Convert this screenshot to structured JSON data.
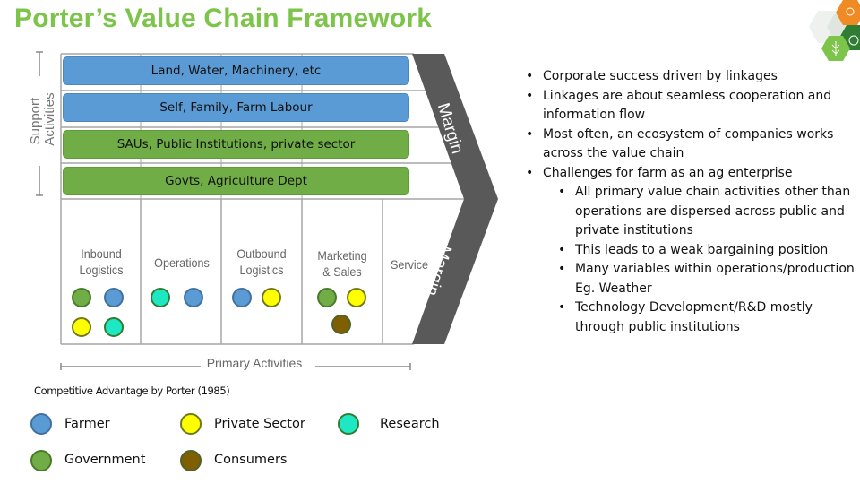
{
  "title": "Porter’s Value Chain Framework",
  "logo": {
    "icon": "hexagon-agriculture-logo-icon",
    "colors": [
      "#f08a24",
      "#2e7d32",
      "#7dc44a",
      "#e8ece8"
    ]
  },
  "diagram": {
    "support_label": "Support Activities",
    "support_label_lines": [
      "Support",
      "Activities"
    ],
    "primary_label": "Primary Activities",
    "margin_label_top": "Margin",
    "margin_label_bottom": "Margin",
    "support_bars": [
      {
        "label": "Land, Water, Machinery, etc",
        "color": "blue"
      },
      {
        "label": "Self, Family, Farm Labour",
        "color": "blue"
      },
      {
        "label": "SAUs, Public Institutions, private sector",
        "color": "green"
      },
      {
        "label": "Govts, Agriculture Dept",
        "color": "green"
      }
    ],
    "primary_columns": [
      {
        "label_lines": [
          "Inbound",
          "Logistics"
        ],
        "actors": [
          "Government",
          "Farmer",
          "Private Sector",
          "Research"
        ]
      },
      {
        "label_lines": [
          "Operations"
        ],
        "actors": [
          "Research",
          "Farmer"
        ]
      },
      {
        "label_lines": [
          "Outbound",
          "Logistics"
        ],
        "actors": [
          "Farmer",
          "Private Sector"
        ]
      },
      {
        "label_lines": [
          "Marketing",
          "& Sales"
        ],
        "actors": [
          "Government",
          "Private Sector",
          "Consumers"
        ]
      },
      {
        "label_lines": [
          "Service"
        ],
        "actors": []
      }
    ],
    "colors": {
      "bar_blue": "#5b9bd5",
      "bar_green": "#70ad47",
      "margin": "#595959",
      "grid": "#a6a6a6"
    }
  },
  "caption": "Competitive Advantage by Porter (1985)",
  "legend": [
    {
      "label": "Farmer",
      "fill": "#5b9bd5",
      "stroke": "#41719c"
    },
    {
      "label": "Private Sector",
      "fill": "#ffff00",
      "stroke": "#6e7a1a"
    },
    {
      "label": "Research",
      "fill": "#1ee8c4",
      "stroke": "#2e7d32"
    },
    {
      "label": "Government",
      "fill": "#70ad47",
      "stroke": "#4a7a2c"
    },
    {
      "label": "Consumers",
      "fill": "#7f5f00",
      "stroke": "#4f6228"
    }
  ],
  "bullets": [
    {
      "text": "Corporate success driven by linkages"
    },
    {
      "text": "Linkages are about seamless cooperation and information flow"
    },
    {
      "text": "Most often, an ecosystem of companies works across the value chain"
    },
    {
      "text": "Challenges for farm as an ag enterprise",
      "children": [
        "All primary value chain activities other than operations are dispersed across public and private institutions",
        "This leads to a weak bargaining position",
        "Many variables within operations/production Eg. Weather",
        "Technology Development/R&D mostly through public institutions"
      ]
    }
  ]
}
